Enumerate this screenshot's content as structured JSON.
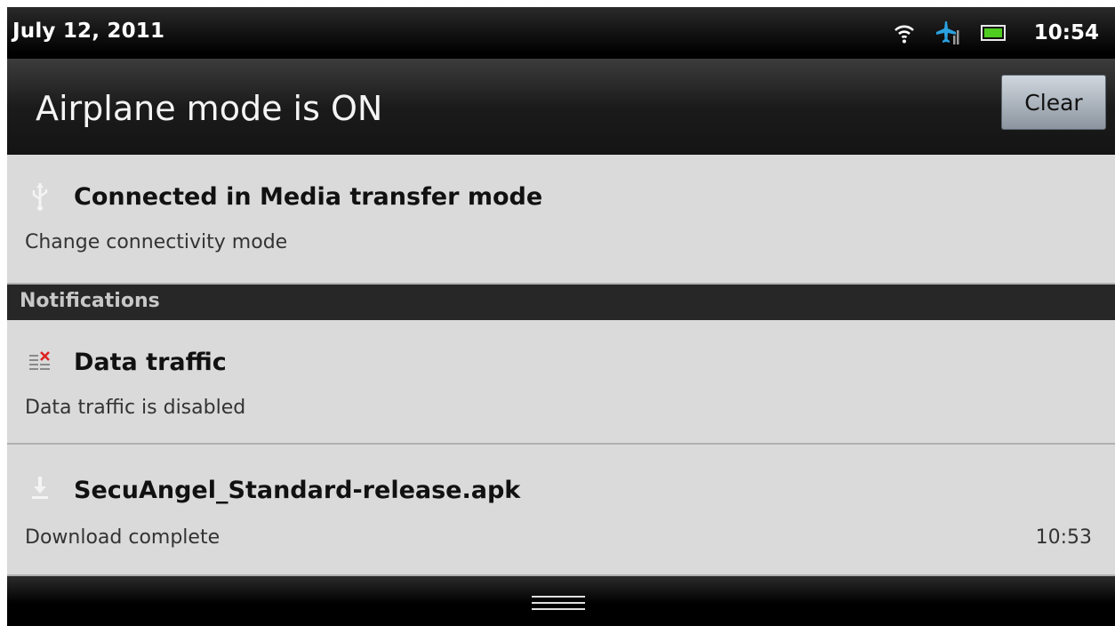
{
  "status_bar": {
    "date": "July 12, 2011",
    "time": "10:54",
    "icons": [
      "wifi-icon",
      "airplane-icon",
      "battery-icon"
    ]
  },
  "header": {
    "title": "Airplane mode is ON",
    "clear_label": "Clear"
  },
  "ongoing": {
    "usb": {
      "icon": "usb-icon",
      "title": "Connected in Media transfer mode",
      "subtitle": "Change connectivity mode"
    }
  },
  "notifications": {
    "header": "Notifications",
    "items": [
      {
        "icon": "data-traffic-icon",
        "title": "Data traffic",
        "subtitle": "Data traffic is disabled"
      },
      {
        "icon": "download-icon",
        "title": "SecuAngel_Standard-release.apk",
        "subtitle": "Download complete",
        "time": "10:53"
      }
    ]
  },
  "colors": {
    "status_bar_bg": "#000000",
    "item_bg": "#dadada",
    "section_header_bg": "#272727",
    "airplane_accent": "#2aa0e0",
    "battery_green": "#4ecc1f"
  }
}
